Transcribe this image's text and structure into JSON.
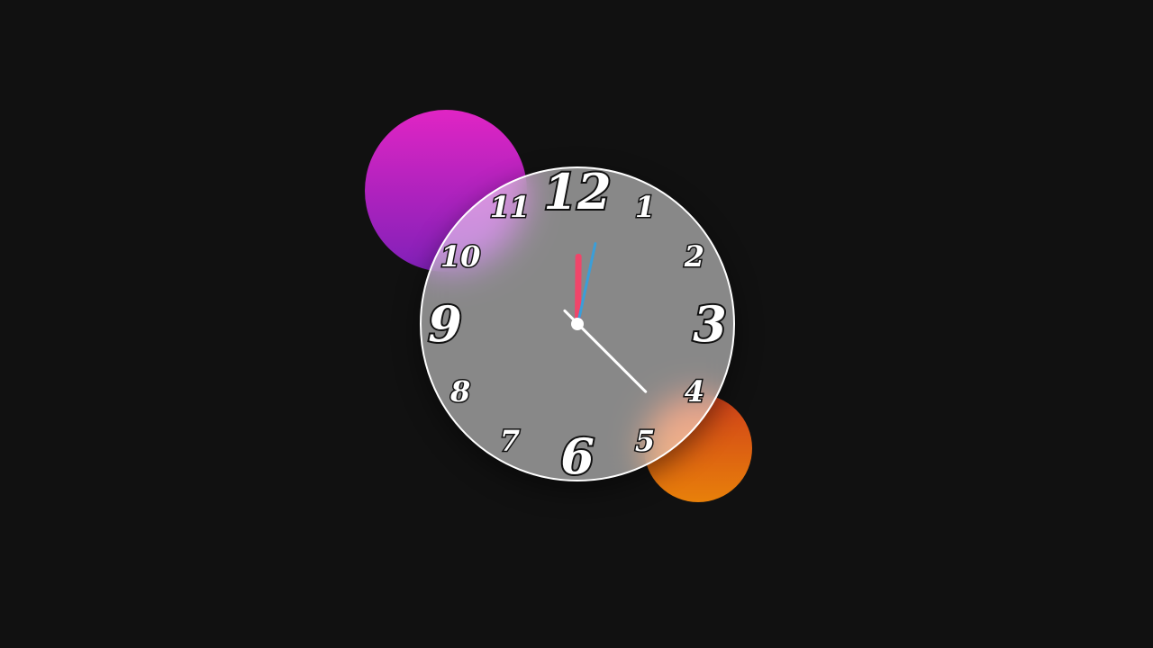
{
  "clock": {
    "time": {
      "hours": 12,
      "minutes": 1,
      "seconds": 22.6
    },
    "numerals": [
      "12",
      "1",
      "2",
      "3",
      "4",
      "5",
      "6",
      "7",
      "8",
      "9",
      "10",
      "11"
    ],
    "colors": {
      "background": "#111111",
      "face": "#8a8a8a",
      "face_border": "#ffffff",
      "numeral_fill": "#ffffff",
      "numeral_outline": "#111111",
      "hour_hand": "#f0456a",
      "minute_hand": "#3b9ed8",
      "second_hand": "#ffffff",
      "center_dot": "#ffffff"
    }
  },
  "decorations": {
    "magenta_circle": {
      "color_top": "#e025c4",
      "color_bottom": "#8020b8"
    },
    "orange_circle": {
      "color_top": "#d0401a",
      "color_bottom": "#e8800a"
    }
  }
}
